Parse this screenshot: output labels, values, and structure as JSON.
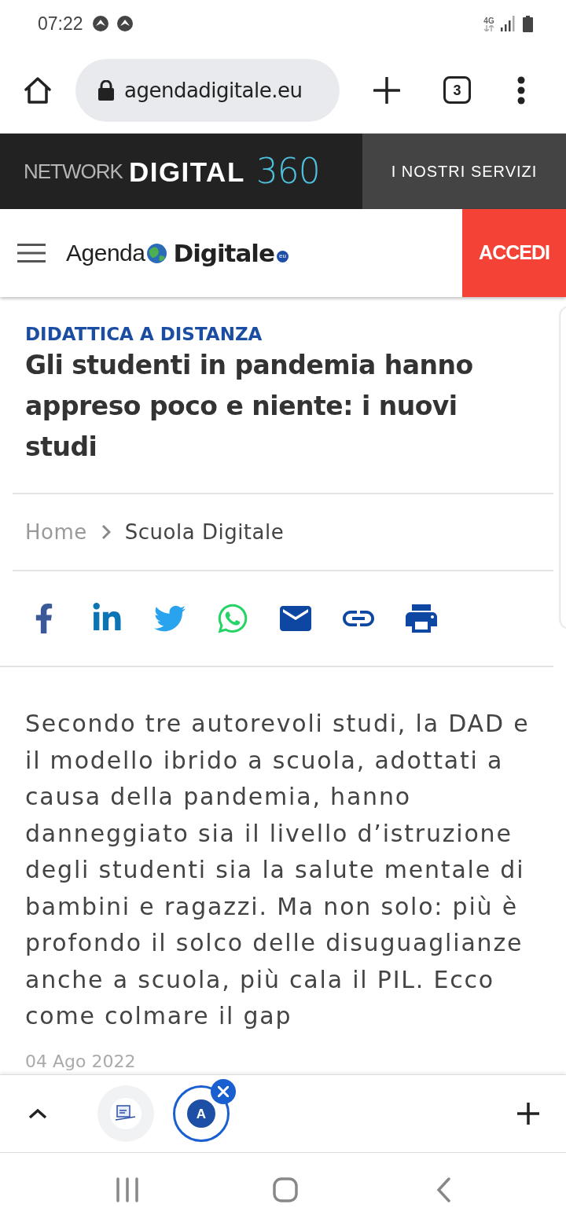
{
  "status_bar": {
    "time": "07:22",
    "network": "4G"
  },
  "browser_toolbar": {
    "url": "agendadigitale.eu",
    "tab_count": "3"
  },
  "network_header": {
    "logo": {
      "network": "NETWORK",
      "digital": "DIGITAL",
      "number": "360"
    },
    "services_button": "I NOSTRI SERVIZI"
  },
  "site_header": {
    "logo": {
      "agenda": "Agenda",
      "digitale": "Digitale",
      "suffix": "eu"
    },
    "login_button": "ACCEDI"
  },
  "article": {
    "category": "DIDATTICA A DISTANZA",
    "title": "Gli studenti in pandemia hanno appreso poco e niente: i nuovi studi",
    "breadcrumb": [
      {
        "label": "Home",
        "current": false
      },
      {
        "label": "Scuola Digitale",
        "current": true
      }
    ],
    "share_buttons": [
      {
        "kind": "facebook"
      },
      {
        "kind": "linkedin"
      },
      {
        "kind": "twitter"
      },
      {
        "kind": "whatsapp"
      },
      {
        "kind": "email"
      },
      {
        "kind": "link"
      },
      {
        "kind": "print"
      }
    ],
    "summary": "Secondo tre autorevoli studi, la DAD e il modello ibrido a scuola, adottati a causa della pandemia, hanno danneggiato sia il livello d’istruzione degli studenti sia la salute mentale di bambini e ragazzi. Ma non solo: più è profondo il solco delle disuguaglianze anche a scuola, più cala il PIL. Ecco come colmare il gap",
    "date": "04 Ago 2022"
  },
  "tab_group_bar": {
    "tabs": [
      {
        "kind": "picture",
        "selected": false
      },
      {
        "kind": "letter",
        "letter": "A",
        "selected": true
      }
    ]
  }
}
